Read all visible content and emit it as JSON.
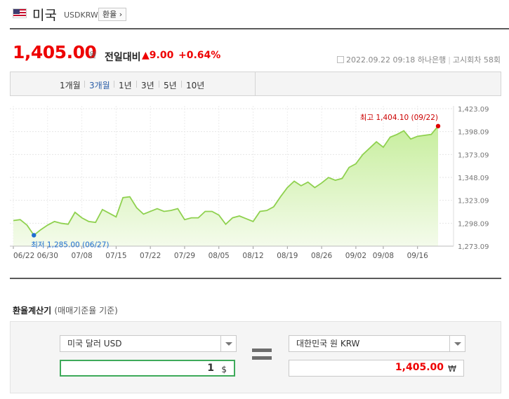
{
  "header": {
    "country": "미국",
    "code": "USDKRW",
    "tag_button": "환율 ›"
  },
  "quote": {
    "price": "1,405.00",
    "unit": "원",
    "compare_label": "전일대비",
    "change": "▲9.00",
    "change_pct": "+0.64%",
    "datetime": "2022.09.22 09:18",
    "bank": "하나은행",
    "notice": "고시회차 58회",
    "accent_color": "#e00000"
  },
  "tabs": [
    "1개월",
    "3개월",
    "1년",
    "3년",
    "5년",
    "10년"
  ],
  "active_tab": "3개월",
  "chart_data": {
    "type": "area",
    "x_tick_labels": [
      "06/22",
      "06/30",
      "07/08",
      "07/15",
      "07/22",
      "07/29",
      "08/05",
      "08/12",
      "08/19",
      "08/26",
      "09/02",
      "09/08",
      "09/16"
    ],
    "y_ticks": [
      1273.09,
      1298.09,
      1323.09,
      1348.09,
      1373.09,
      1398.09,
      1423.09
    ],
    "y_tick_labels": [
      "1,273.09",
      "1,298.09",
      "1,323.09",
      "1,348.09",
      "1,373.09",
      "1,398.09",
      "1,423.09"
    ],
    "ylim": [
      1273.09,
      1423.09
    ],
    "grid": true,
    "line_color": "#8fd14f",
    "fill_color": "#dff5c4",
    "series": [
      {
        "values": [
          1301,
          1302,
          1296,
          1285,
          1291,
          1296,
          1300,
          1298,
          1297,
          1310,
          1304,
          1300,
          1299,
          1313,
          1309,
          1305,
          1326,
          1327,
          1315,
          1308,
          1311,
          1314,
          1311,
          1312,
          1314,
          1302,
          1304,
          1304,
          1311,
          1311,
          1307,
          1297,
          1304,
          1306,
          1303,
          1300,
          1311,
          1312,
          1316,
          1327,
          1337,
          1344,
          1339,
          1343,
          1337,
          1342,
          1348,
          1345,
          1347,
          1359,
          1363,
          1373,
          1380,
          1387,
          1381,
          1392,
          1395,
          1399,
          1390,
          1393,
          1394,
          1395,
          1404.1
        ]
      }
    ],
    "high": {
      "label": "최고 1,404.10 (09/22)",
      "value": 1404.1,
      "index": 62,
      "color": "#e00000"
    },
    "low": {
      "label": "최저 1,285.00 (06/27)",
      "value": 1285.0,
      "index": 3,
      "color": "#1f6fd0"
    }
  },
  "calculator": {
    "title": "환율계산기",
    "subtitle": "(매매기준율 기준)",
    "from_currency": "미국 달러 USD",
    "to_currency": "대한민국 원 KRW",
    "from_amount": "1",
    "from_unit": "$",
    "to_amount": "1,405.00",
    "to_unit": "₩"
  }
}
